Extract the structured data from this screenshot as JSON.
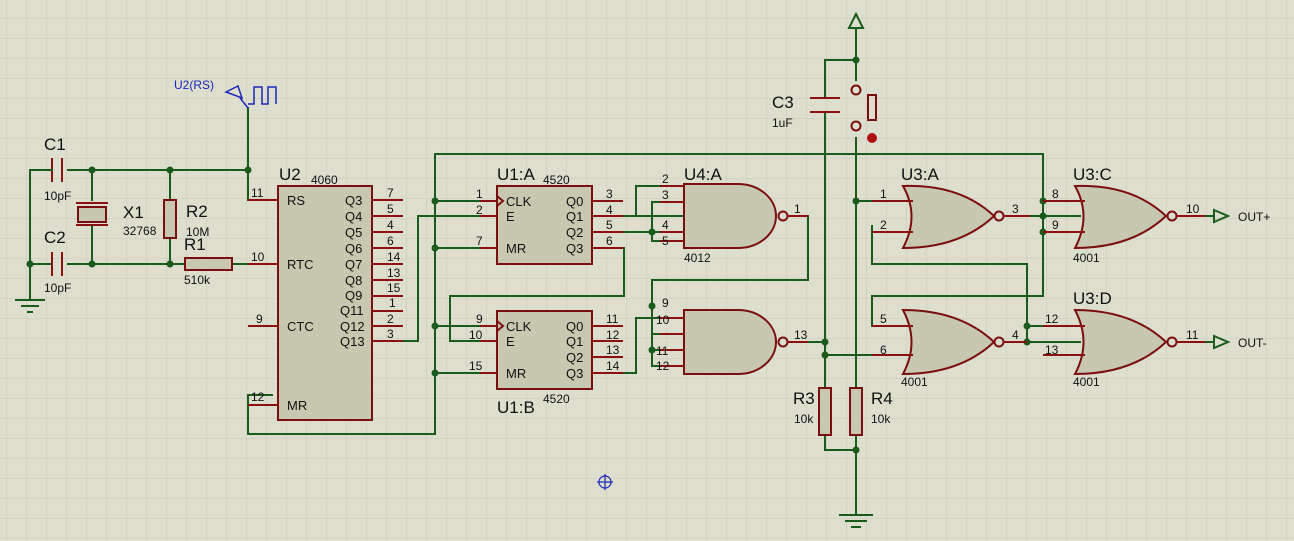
{
  "components": {
    "C1": {
      "ref": "C1",
      "value": "10pF"
    },
    "C2": {
      "ref": "C2",
      "value": "10pF"
    },
    "X1": {
      "ref": "X1",
      "value": "32768"
    },
    "R2": {
      "ref": "R2",
      "value": "10M"
    },
    "R1": {
      "ref": "R1",
      "value": "510k"
    },
    "C3": {
      "ref": "C3",
      "value": "1uF"
    },
    "R3": {
      "ref": "R3",
      "value": "10k"
    },
    "R4": {
      "ref": "R4",
      "value": "10k"
    },
    "U2": {
      "ref": "U2",
      "part": "4060",
      "pins_left": [
        {
          "num": "11",
          "name": "RS"
        },
        {
          "num": "10",
          "name": "RTC"
        },
        {
          "num": "9",
          "name": "CTC"
        },
        {
          "num": "12",
          "name": "MR"
        }
      ],
      "pins_right": [
        {
          "num": "7",
          "name": "Q3"
        },
        {
          "num": "5",
          "name": "Q4"
        },
        {
          "num": "4",
          "name": "Q5"
        },
        {
          "num": "6",
          "name": "Q6"
        },
        {
          "num": "14",
          "name": "Q7"
        },
        {
          "num": "13",
          "name": "Q8"
        },
        {
          "num": "15",
          "name": "Q9"
        },
        {
          "num": "1",
          "name": "Q11"
        },
        {
          "num": "2",
          "name": "Q12"
        },
        {
          "num": "3",
          "name": "Q13"
        }
      ]
    },
    "U1A": {
      "ref": "U1:A",
      "part": "4520",
      "pins_left": [
        {
          "num": "1",
          "name": "CLK"
        },
        {
          "num": "2",
          "name": "E"
        },
        {
          "num": "7",
          "name": "MR"
        }
      ],
      "pins_right": [
        {
          "num": "3",
          "name": "Q0"
        },
        {
          "num": "4",
          "name": "Q1"
        },
        {
          "num": "5",
          "name": "Q2"
        },
        {
          "num": "6",
          "name": "Q3"
        }
      ]
    },
    "U1B": {
      "ref": "U1:B",
      "part": "4520",
      "pins_left": [
        {
          "num": "9",
          "name": "CLK"
        },
        {
          "num": "10",
          "name": "E"
        },
        {
          "num": "15",
          "name": "MR"
        }
      ],
      "pins_right": [
        {
          "num": "11",
          "name": "Q0"
        },
        {
          "num": "12",
          "name": "Q1"
        },
        {
          "num": "13",
          "name": "Q2"
        },
        {
          "num": "14",
          "name": "Q3"
        }
      ]
    },
    "U4A": {
      "ref": "U4:A",
      "part": "4012",
      "inputs": [
        "2",
        "3",
        "4",
        "5"
      ],
      "output": "1"
    },
    "U4B": {
      "ref": "",
      "part": "",
      "inputs": [
        "9",
        "10",
        "11",
        "12"
      ],
      "output": "13"
    },
    "U3A": {
      "ref": "U3:A",
      "part": "",
      "inputs": [
        "1",
        "2"
      ],
      "output": "3"
    },
    "U3B": {
      "ref": "",
      "part": "4001",
      "inputs": [
        "5",
        "6"
      ],
      "output": "4"
    },
    "U3C": {
      "ref": "U3:C",
      "part": "4001",
      "inputs": [
        "8",
        "9"
      ],
      "output": "10"
    },
    "U3D": {
      "ref": "U3:D",
      "part": "4001",
      "inputs": [
        "12",
        "13"
      ],
      "output": "11"
    }
  },
  "probe": {
    "label": "U2(RS)"
  },
  "terminals": {
    "out_plus": "OUT+",
    "out_minus": "OUT-"
  }
}
